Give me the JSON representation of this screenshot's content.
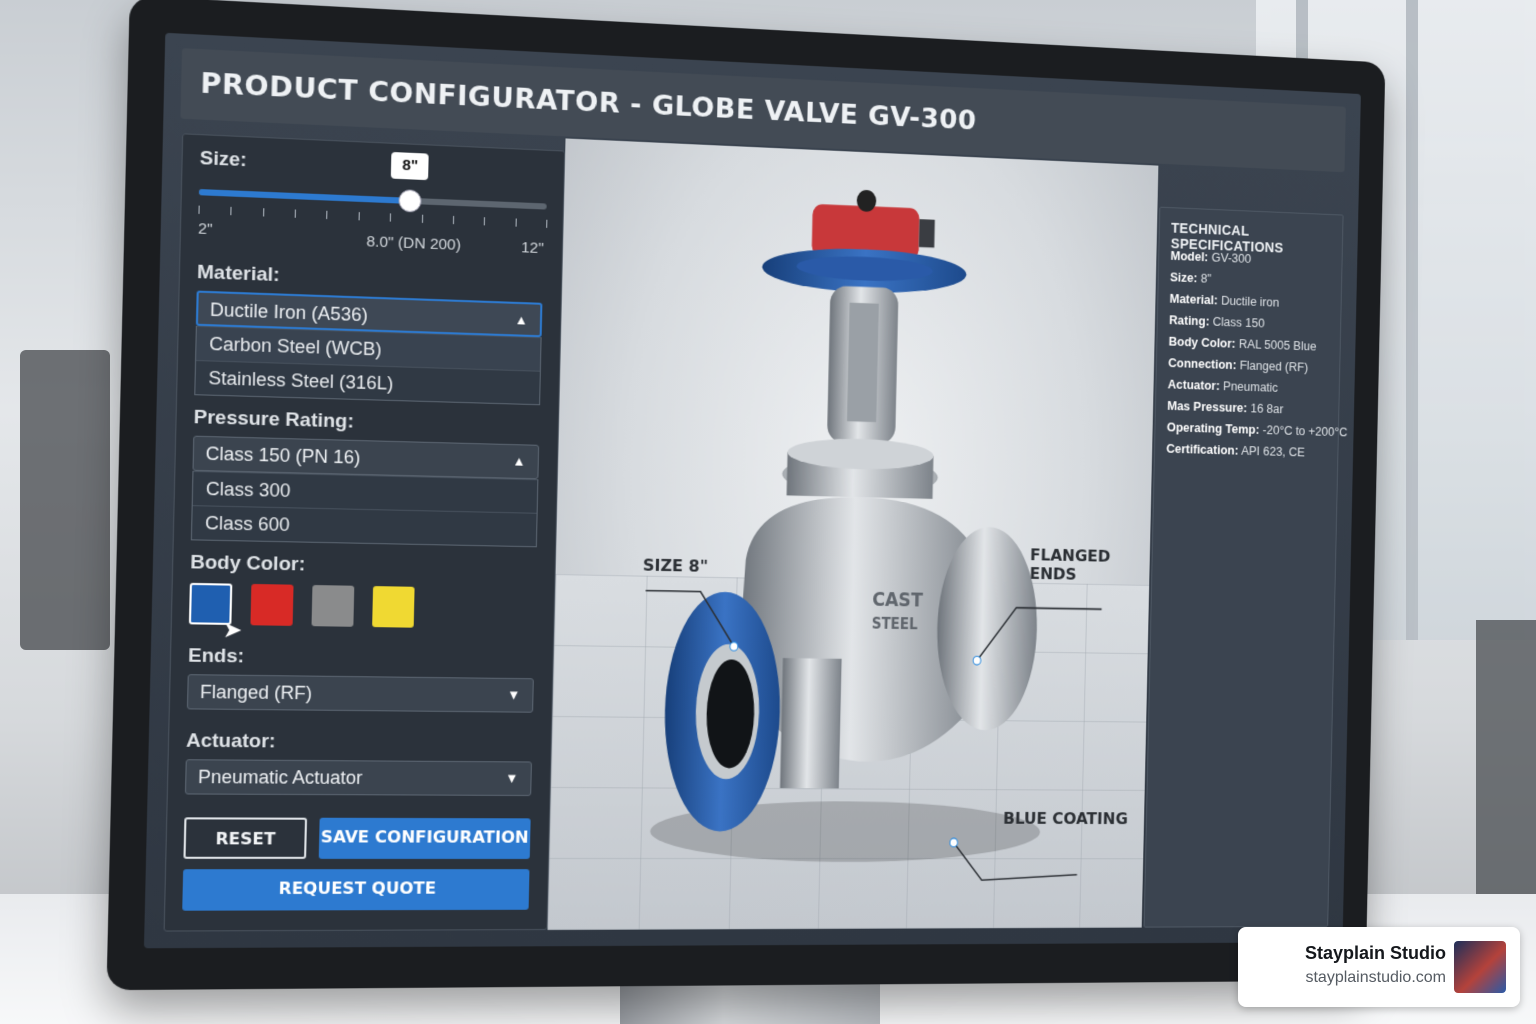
{
  "window": {
    "title": "PRODUCT CONFIGURATOR - GLOBE VALVE GV-300"
  },
  "size": {
    "label": "Size:",
    "value_bubble": "8\"",
    "min_label": "2\"",
    "mid_label": "8.0\" (DN 200)",
    "max_label": "12\"",
    "level_fraction": 0.6
  },
  "material": {
    "label": "Material:",
    "selected": "Ductile Iron (A536)",
    "options": [
      "Carbon Steel (WCB)",
      "Stainless Steel (316L)"
    ]
  },
  "pressure": {
    "label": "Pressure Rating:",
    "selected": "Class 150 (PN 16)",
    "options": [
      "Class 300",
      "Class 600"
    ]
  },
  "body_color": {
    "label": "Body Color:",
    "swatches": [
      {
        "name": "blue",
        "hex": "#1f5fb0"
      },
      {
        "name": "red",
        "hex": "#d82a26"
      },
      {
        "name": "gray",
        "hex": "#8a8b8c"
      },
      {
        "name": "yellow",
        "hex": "#f0d932"
      }
    ]
  },
  "ends": {
    "label": "Ends:",
    "selected": "Flanged (RF)"
  },
  "actuator": {
    "label": "Actuator:",
    "selected": "Pneumatic Actuator"
  },
  "buttons": {
    "reset": "RESET",
    "save": "SAVE CONFIGURATION",
    "quote": "REQUEST QUOTE"
  },
  "viewer": {
    "callout_size": "SIZE 8\"",
    "callout_flanged": "FLANGED ENDS",
    "callout_coating": "BLUE COATING",
    "body_text_1": "CAST",
    "body_text_2": "STEEL"
  },
  "specs": {
    "title": "TECHNICAL SPECIFICATIONS",
    "rows": [
      {
        "key": "Model:",
        "value": "GV-300"
      },
      {
        "key": "Size:",
        "value": "8\""
      },
      {
        "key": "Material:",
        "value": "Ductile iron"
      },
      {
        "key": "Rating:",
        "value": "Class 150"
      },
      {
        "key": "Body Color:",
        "value": "RAL 5005 Blue"
      },
      {
        "key": "Connection:",
        "value": "Flanged (RF)"
      },
      {
        "key": "Actuator:",
        "value": "Pneumatic"
      },
      {
        "key": "Mas Pressure:",
        "value": "16 8ar"
      },
      {
        "key": "Operating Temp:",
        "value": "-20°C to +200°C"
      },
      {
        "key": "Certification:",
        "value": "API 623, CE"
      }
    ]
  },
  "watermark": {
    "name": "Stayplain Studio",
    "url": "stayplainstudio.com"
  },
  "colors": {
    "accent": "#2d7ad0",
    "panel": "#2b323b",
    "valve_blue": "#2459a8",
    "actuator_red": "#c8383a"
  }
}
